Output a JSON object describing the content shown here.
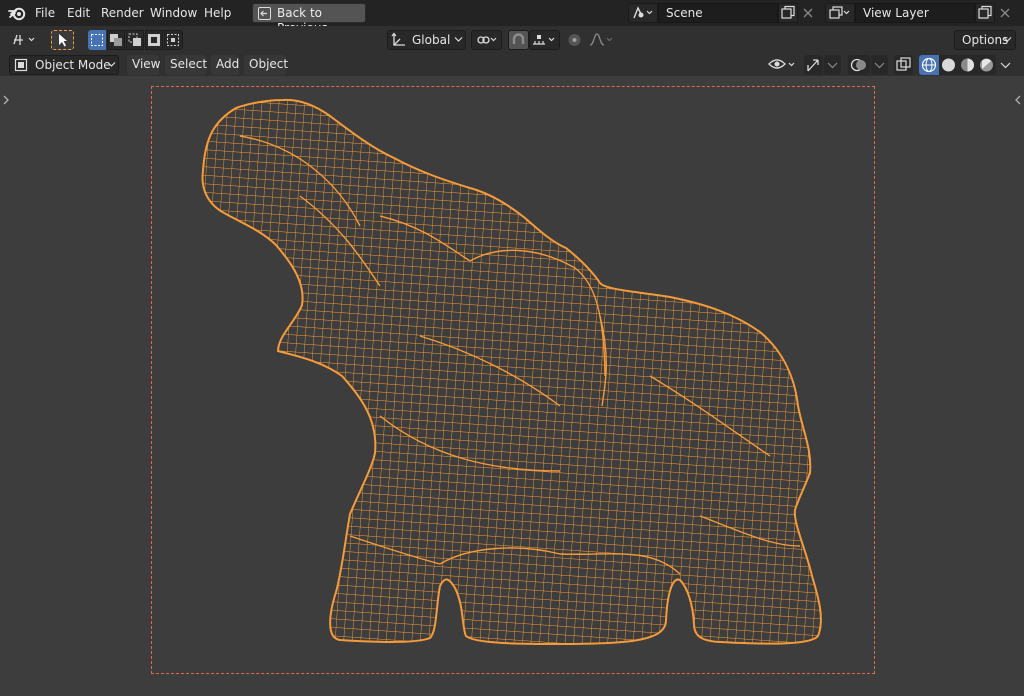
{
  "menubar": {
    "items": [
      "File",
      "Edit",
      "Render",
      "Window",
      "Help"
    ],
    "back_button": "Back to Previous"
  },
  "scene": {
    "name": "Scene"
  },
  "view_layer": {
    "name": "View Layer"
  },
  "toolbar": {
    "transform_orientation": "Global",
    "options_label": "Options"
  },
  "header": {
    "mode": "Object Mode",
    "menus": [
      "View",
      "Select",
      "Add",
      "Object"
    ]
  },
  "viewport": {
    "object_icon": "elephant-wireframe",
    "wire_color": "#f59b3a",
    "camera_frame_color": "#e0684f"
  },
  "colors": {
    "accent": "#4772b3",
    "background": "#3d3d3d"
  }
}
